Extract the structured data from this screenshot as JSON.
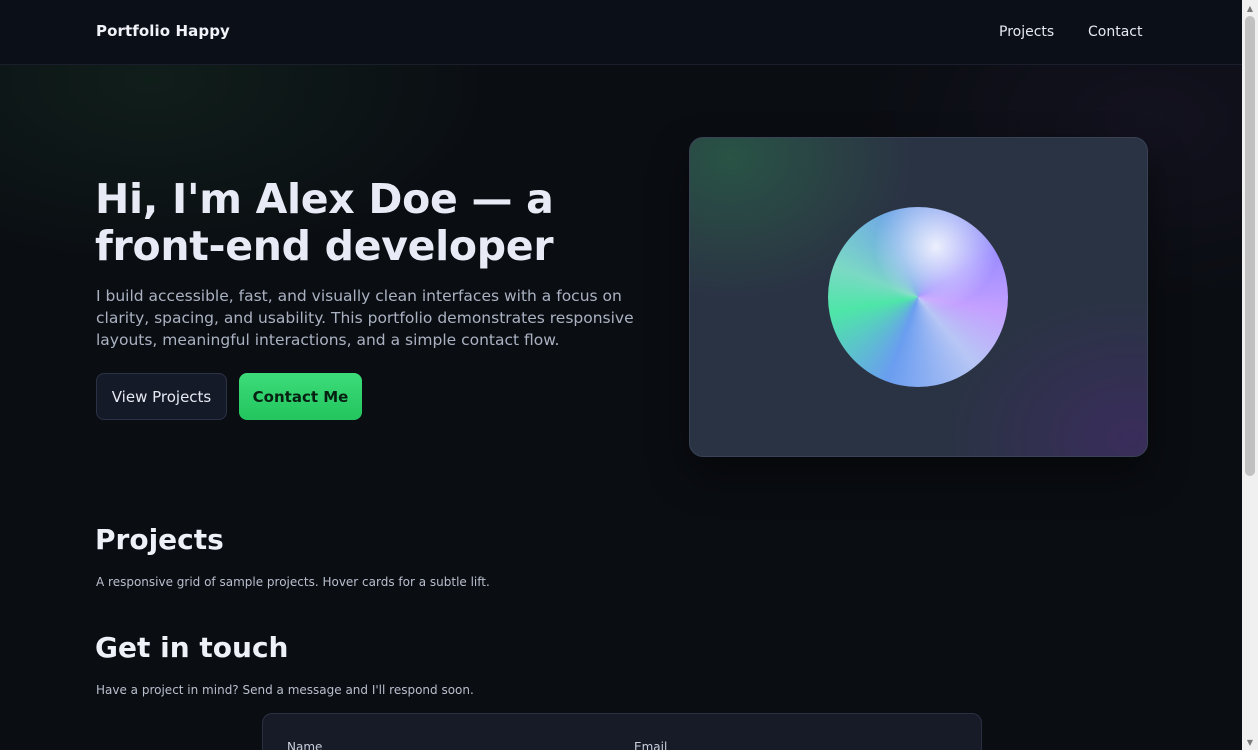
{
  "header": {
    "brand": "Portfolio Happy",
    "nav": [
      {
        "label": "Projects"
      },
      {
        "label": "Contact"
      }
    ]
  },
  "hero": {
    "title": "Hi, I'm Alex Doe — a front-end developer",
    "text": "I build accessible, fast, and visually clean interfaces with a focus on clarity, spacing, and usability. This portfolio demonstrates responsive layouts, meaningful interactions, and a simple contact flow.",
    "secondary_button": "View Projects",
    "primary_button": "Contact Me"
  },
  "projects": {
    "title": "Projects",
    "description": "A responsive grid of sample projects. Hover cards for a subtle lift."
  },
  "contact": {
    "title": "Get in touch",
    "description": "Have a project in mind? Send a message and I'll respond soon.",
    "name_label": "Name",
    "email_label": "Email"
  },
  "scrollbar": {
    "up_icon": "▲",
    "down_icon": "▼"
  },
  "colors": {
    "background": "#0a0d12",
    "accent": "#22c55e",
    "text": "#e6e9f2"
  }
}
